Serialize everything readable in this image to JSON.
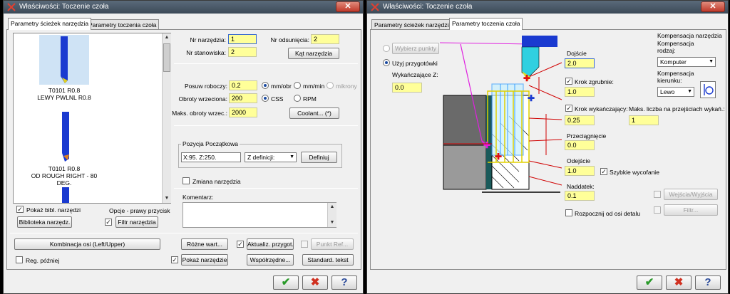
{
  "left": {
    "title": "Właściwości: Toczenie czoła",
    "tabs": [
      "Parametry ścieżek narzędzia",
      "Parametry toczenia czoła"
    ],
    "tools": [
      {
        "name": "T0101 R0.8",
        "desc": "LEWY PWLNL R0.8"
      },
      {
        "name": "T0101 R0.8",
        "desc": "OD ROUGH RIGHT - 80 DEG."
      }
    ],
    "nr_narzedzia_label": "Nr narzędzia:",
    "nr_narzedzia": "1",
    "nr_odsuniecia_label": "Nr odsunięcia:",
    "nr_odsuniecia": "2",
    "nr_stanowiska_label": "Nr stanowiska:",
    "nr_stanowiska": "2",
    "kat_button": "Kąt narzędzia",
    "posuw_label": "Posuw roboczy:",
    "posuw": "0.2",
    "mm_obr": "mm/obr",
    "mm_min": "mm/min",
    "mikrony": "mikrony",
    "obroty_label": "Obroty wrzeciona:",
    "obroty": "200",
    "css": "CSS",
    "rpm": "RPM",
    "maks_label": "Maks. obroty wrzec.:",
    "maks": "2000",
    "coolant": "Coolant... (*)",
    "pozycja_label": "Pozycja Początkowa",
    "pozycja_value": "X:95.  Z:250.",
    "z_definicji": "Z definicji:",
    "definiuj": "Definiuj",
    "zmiana": "Zmiana narzędzia",
    "komentarz": "Komentarz:",
    "pokaz_bibl": "Pokaż bibl. narzędzi",
    "opcje": "Opcje - prawy przycisk",
    "biblioteka": "Biblioteka narzędz.",
    "filtr": "Filtr narzędzia",
    "kombinacja": "Kombinacja osi (Left/Upper)",
    "rozne": "Różne wart...",
    "aktualiz": "Aktualiz. przygot.",
    "punkt_ref": "Punkt Ref...",
    "reg_pozniej": "Reg. później",
    "pokaz_narz": "Pokaż narzędzie",
    "wspolrzedne": "Współrzędne...",
    "standard": "Standard. tekst"
  },
  "right": {
    "title": "Właściwości: Toczenie czoła",
    "tabs": [
      "Parametry ścieżek narzędzia",
      "Parametry toczenia czoła"
    ],
    "wybierz": "Wybierz punkty",
    "uzyj": "Użyj przygotówki",
    "wykanczajace_label": "Wykańczające Z:",
    "wykanczajace": "0.0",
    "dojscie_label": "Dojście",
    "dojscie": "2.0",
    "krok_zgrubnie_label": "Krok zgrubnie:",
    "krok_zgrubnie": "1.0",
    "krok_wyk_label": "Krok wykańczający:",
    "krok_wyk": "0.25",
    "maks_liczba_label": "Maks. liczba na przejściach wykań.:",
    "maks_liczba": "1",
    "przeciagniecie_label": "Przeciągnięcie",
    "przeciagniecie": "0.0",
    "odejscie_label": "Odejście",
    "odejscie": "1.0",
    "szybkie": "Szybkie wycofanie",
    "naddatek_label": "Naddatek:",
    "naddatek": "0.1",
    "rozpocznij": "Rozpocznij od osi detalu",
    "komp_title": "Kompensacja narzędzia",
    "komp_rodzaj": "Kompensacja rodzaj:",
    "komp_rodzaj_value": "Komputer",
    "komp_kierunek": "Kompensacja kierunku:",
    "komp_kierunek_value": "Lewo",
    "wejscia": "Wejścia/Wyjścia",
    "filtr": "Filtr..."
  }
}
